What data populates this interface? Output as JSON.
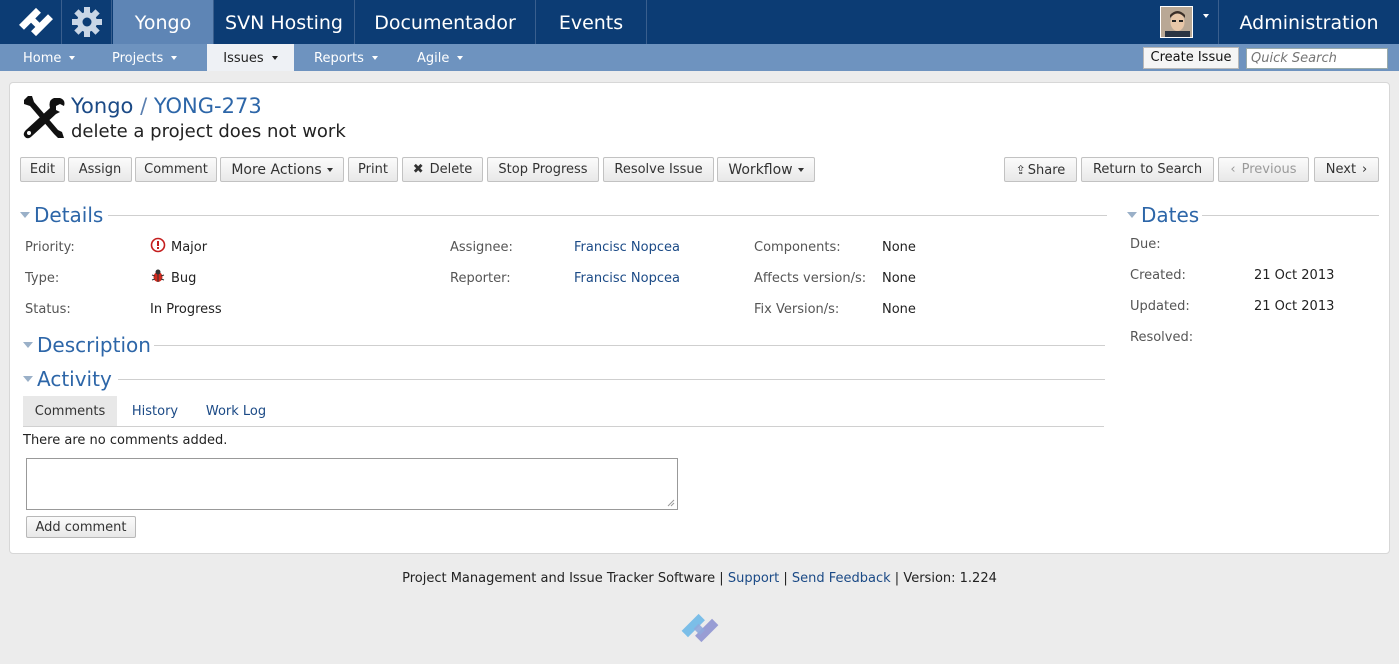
{
  "topnav": {
    "tabs": [
      "Yongo",
      "SVN Hosting",
      "Documentador",
      "Events"
    ],
    "admin": "Administration"
  },
  "subnav": {
    "items": [
      "Home",
      "Projects",
      "Issues",
      "Reports",
      "Agile"
    ],
    "create_issue": "Create Issue",
    "quick_search_placeholder": "Quick Search"
  },
  "issue": {
    "project": "Yongo",
    "separator": "/",
    "key": "YONG-273",
    "summary": "delete a project does not work"
  },
  "actions": {
    "edit": "Edit",
    "assign": "Assign",
    "comment": "Comment",
    "more_actions": "More Actions",
    "print": "Print",
    "delete": "Delete",
    "stop_progress": "Stop Progress",
    "resolve": "Resolve Issue",
    "workflow": "Workflow",
    "share": "Share",
    "return_to_search": "Return to Search",
    "previous": "Previous",
    "next": "Next"
  },
  "details": {
    "title": "Details",
    "priority_label": "Priority:",
    "priority": "Major",
    "type_label": "Type:",
    "type": "Bug",
    "status_label": "Status:",
    "status": "In Progress",
    "assignee_label": "Assignee:",
    "assignee": "Francisc Nopcea",
    "reporter_label": "Reporter:",
    "reporter": "Francisc Nopcea",
    "components_label": "Components:",
    "components": "None",
    "affects_label": "Affects version/s:",
    "affects": "None",
    "fix_label": "Fix Version/s:",
    "fix": "None"
  },
  "dates": {
    "title": "Dates",
    "due_label": "Due:",
    "created_label": "Created:",
    "created": "21 Oct 2013",
    "updated_label": "Updated:",
    "updated": "21 Oct 2013",
    "resolved_label": "Resolved:"
  },
  "description": {
    "title": "Description"
  },
  "activity": {
    "title": "Activity",
    "tabs": [
      "Comments",
      "History",
      "Work Log"
    ],
    "empty": "There are no comments added.",
    "add_comment": "Add comment"
  },
  "footer": {
    "text": "Project Management and Issue Tracker Software",
    "support": "Support",
    "feedback": "Send Feedback",
    "version": "Version: 1.224"
  },
  "colors": {
    "topbar": "#0c3c74",
    "subnav": "#6e93bf",
    "link": "#1b4a86",
    "section": "#2d66a8"
  }
}
